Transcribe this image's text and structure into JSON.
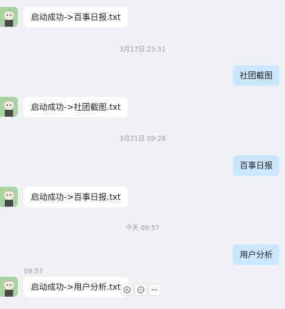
{
  "messages": [
    {
      "side": "left",
      "text": "启动成功->百事日报.txt"
    },
    {
      "side": "time",
      "text": "3月17日 23:31"
    },
    {
      "side": "right",
      "text": "社团截图"
    },
    {
      "side": "left",
      "text": "启动成功->社团截图.txt"
    },
    {
      "side": "time",
      "text": "3月21日 09:28"
    },
    {
      "side": "right",
      "text": "百事日报"
    },
    {
      "side": "left",
      "text": "启动成功->百事日报.txt"
    },
    {
      "side": "time",
      "text": "今天 09:57"
    },
    {
      "side": "right",
      "text": "用户分析"
    },
    {
      "side": "left",
      "text": "启动成功->用户分析.txt",
      "timestamp": "09:57"
    }
  ],
  "hover_actions": [
    {
      "icon": "quote-icon"
    },
    {
      "icon": "reply-icon"
    },
    {
      "icon": "more-icon"
    }
  ],
  "colors": {
    "background": "#f0f1f4",
    "bubble_left": "#ffffff",
    "bubble_right": "#c9e7fd",
    "avatar_bg": "#a7d4a0"
  }
}
